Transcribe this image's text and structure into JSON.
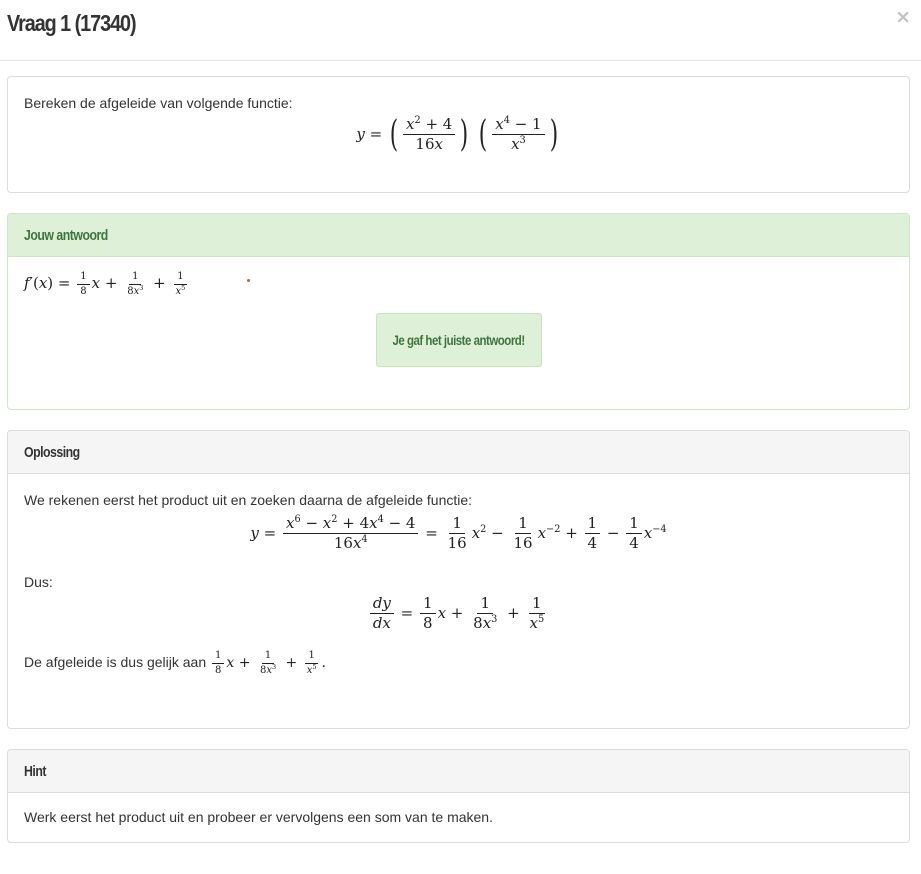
{
  "modal": {
    "title": "Vraag 1 (17340)",
    "close_label": "×"
  },
  "question": {
    "text": "Bereken de afgeleide van volgende functie:"
  },
  "answer": {
    "heading": "Jouw antwoord",
    "feedback": "Je gaf het juiste antwoord!"
  },
  "solution": {
    "heading": "Oplossing",
    "intro": "We rekenen eerst het product uit en zoeken daarna de afgeleide functie:",
    "dus": "Dus:",
    "conclusion": "De afgeleide is dus gelijk aan"
  },
  "hint": {
    "heading": "Hint",
    "text": "Werk eerst het product uit en probeer er vervolgens een som van te maken."
  },
  "colors": {
    "success_bg": "#dff0d8",
    "success_text": "#3c763d",
    "panel_heading_bg": "#f5f5f5",
    "error_dot": "#d9534f"
  },
  "icons": {
    "close": "close-icon"
  }
}
